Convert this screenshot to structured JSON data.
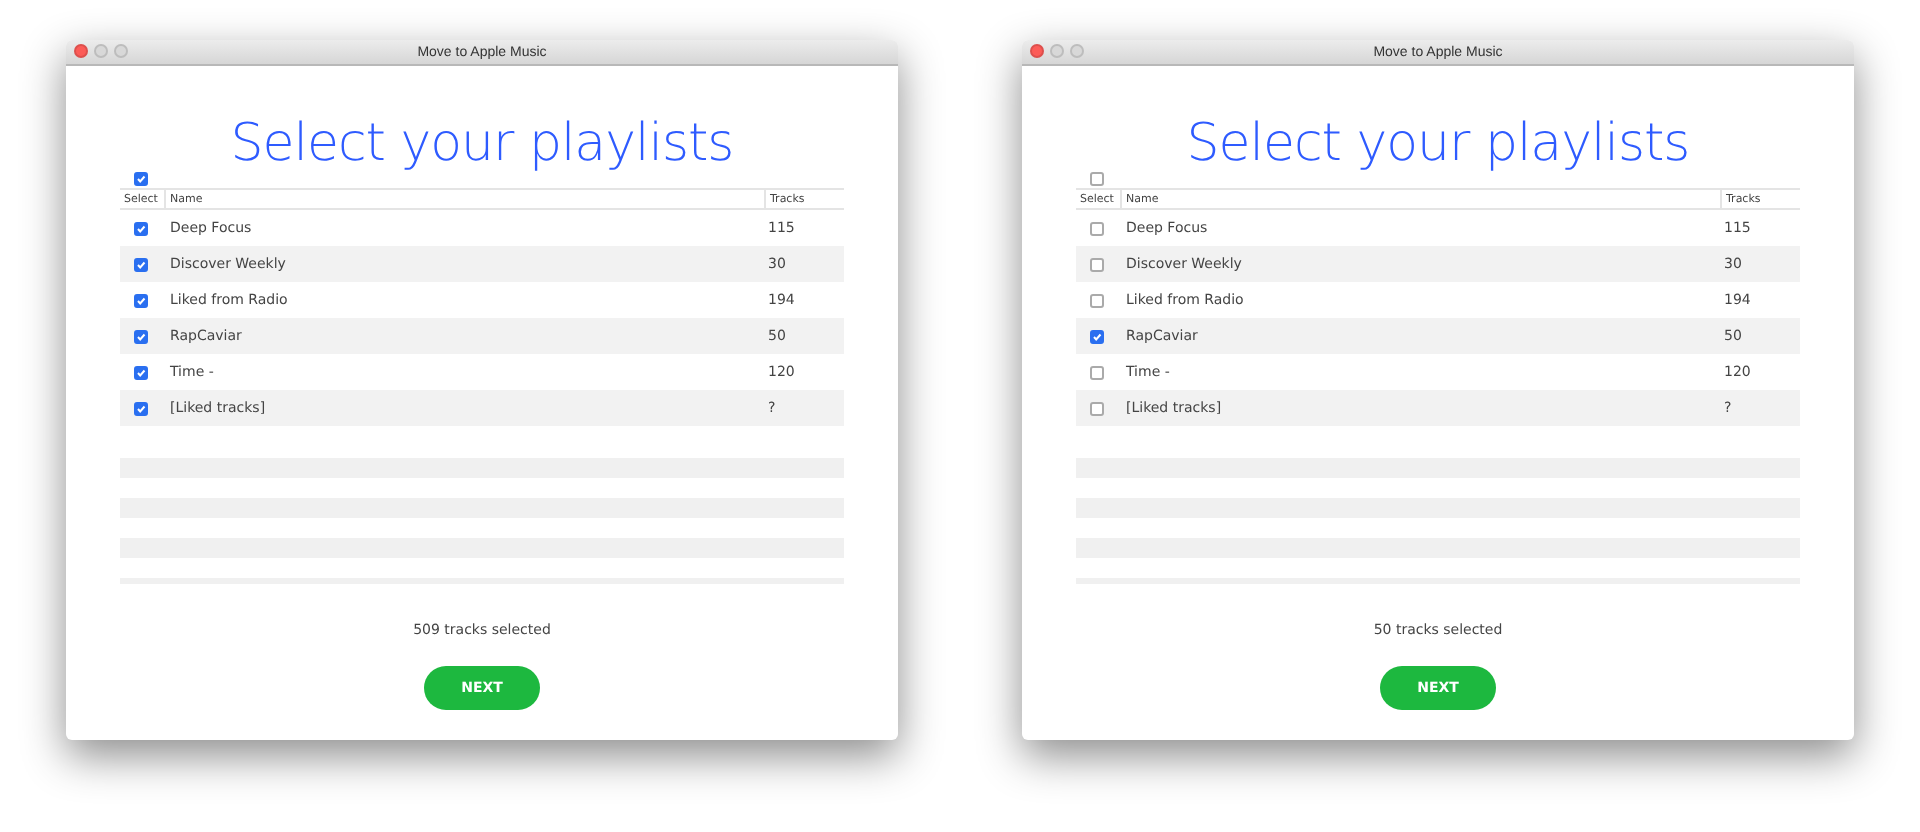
{
  "windows": [
    {
      "title": "Move to Apple Music",
      "heading": "Select your playlists",
      "select_all": {
        "checked": true
      },
      "columns": [
        "Select",
        "Name",
        "Tracks"
      ],
      "rows": [
        {
          "name": "Deep Focus",
          "tracks": "115",
          "checked": true
        },
        {
          "name": "Discover Weekly",
          "tracks": "30",
          "checked": true
        },
        {
          "name": "Liked from Radio",
          "tracks": "194",
          "checked": true
        },
        {
          "name": "RapCaviar",
          "tracks": "50",
          "checked": true
        },
        {
          "name": "Time -",
          "tracks": "120",
          "checked": true
        },
        {
          "name": "[Liked tracks]",
          "tracks": "?",
          "checked": true
        }
      ],
      "summary": "509 tracks selected",
      "button": "NEXT"
    },
    {
      "title": "Move to Apple Music",
      "heading": "Select your playlists",
      "select_all": {
        "checked": false
      },
      "columns": [
        "Select",
        "Name",
        "Tracks"
      ],
      "rows": [
        {
          "name": "Deep Focus",
          "tracks": "115",
          "checked": false
        },
        {
          "name": "Discover Weekly",
          "tracks": "30",
          "checked": false
        },
        {
          "name": "Liked from Radio",
          "tracks": "194",
          "checked": false
        },
        {
          "name": "RapCaviar",
          "tracks": "50",
          "checked": true
        },
        {
          "name": "Time -",
          "tracks": "120",
          "checked": false
        },
        {
          "name": "[Liked tracks]",
          "tracks": "?",
          "checked": false
        }
      ],
      "summary": "50 tracks selected",
      "button": "NEXT"
    }
  ]
}
